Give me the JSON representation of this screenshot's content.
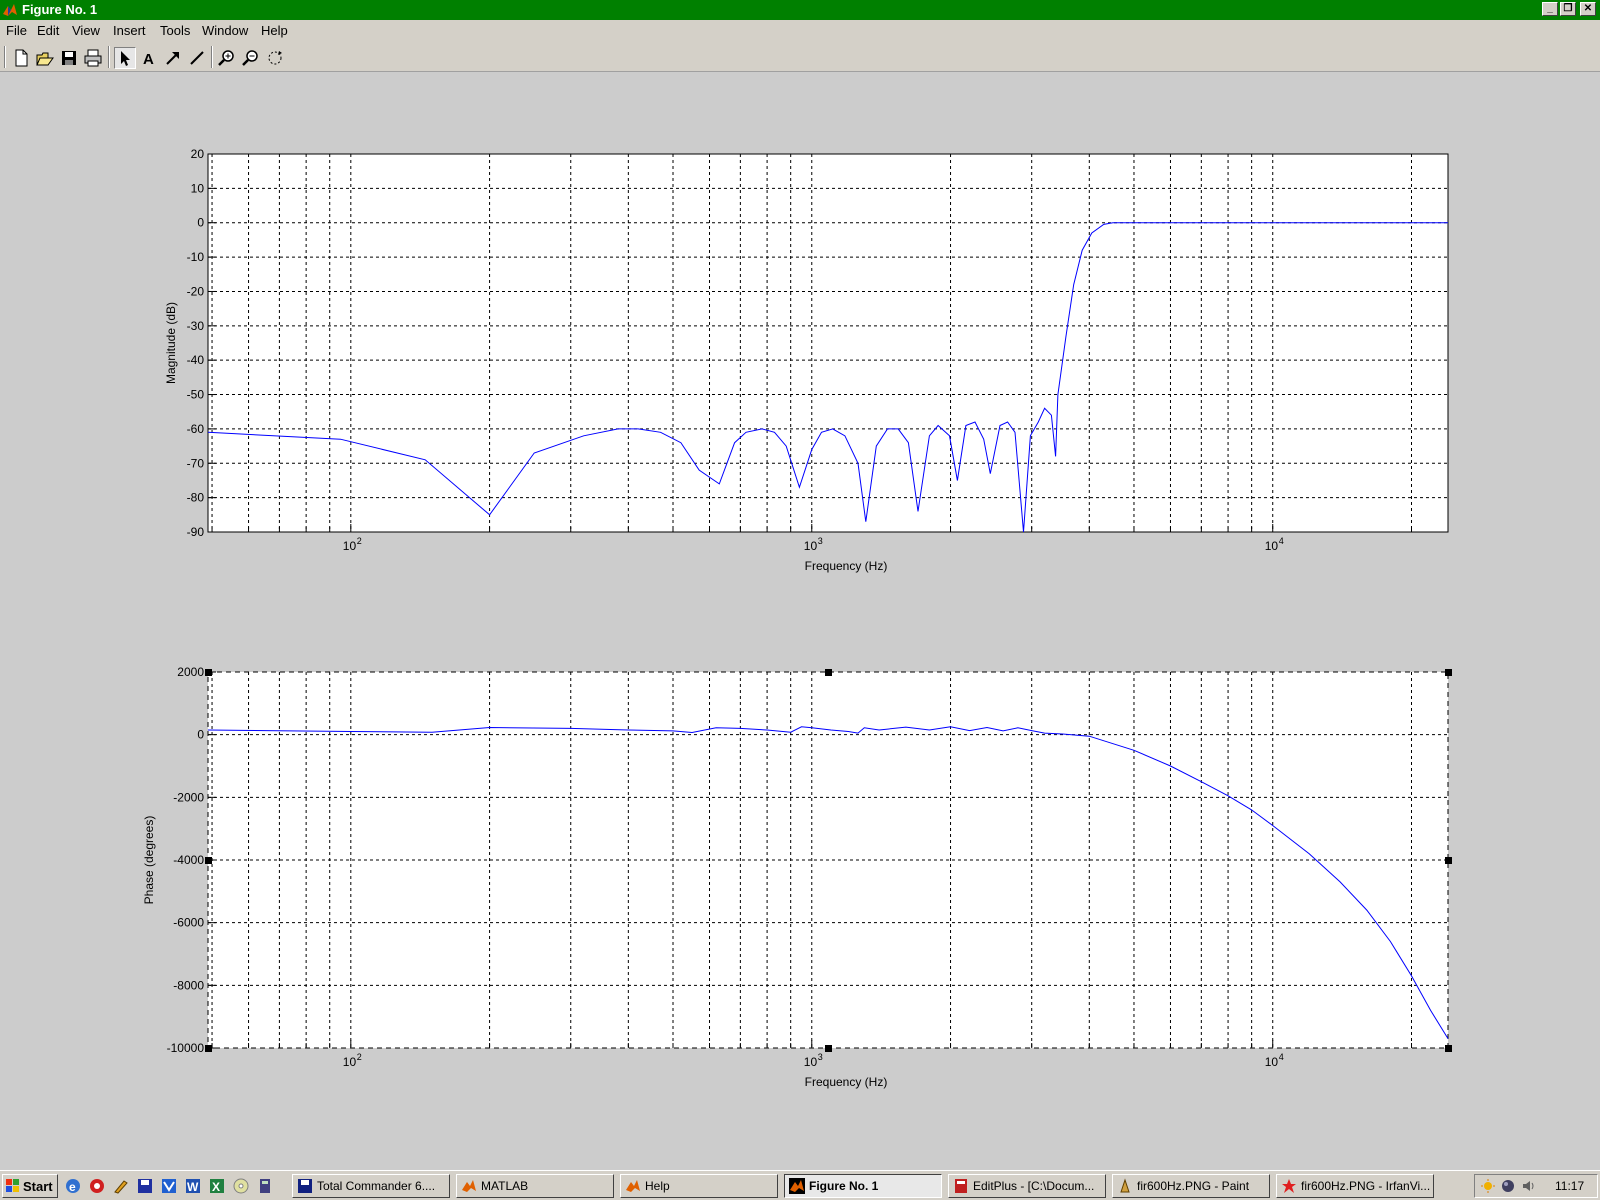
{
  "window": {
    "title": "Figure No. 1",
    "buttons": {
      "minimize": "_",
      "restore": "❐",
      "close": "✕"
    }
  },
  "menu": {
    "items": [
      "File",
      "Edit",
      "View",
      "Insert",
      "Tools",
      "Window",
      "Help"
    ]
  },
  "toolbar": {
    "tools": [
      "new-icon",
      "open-icon",
      "save-icon",
      "print-icon",
      "select-arrow-icon",
      "text-icon",
      "arrow-icon",
      "line-icon",
      "zoom-in-icon",
      "zoom-out-icon",
      "rotate-icon"
    ],
    "active_tool": "select-arrow-icon"
  },
  "chart_data": [
    {
      "type": "line",
      "title": "",
      "xlabel": "Frequency (Hz)",
      "ylabel": "Magnitude (dB)",
      "xscale": "log",
      "xlim": [
        49,
        24000
      ],
      "ylim": [
        -90,
        20
      ],
      "yticks": [
        "20",
        "10",
        "0",
        "-10",
        "-20",
        "-30",
        "-40",
        "-50",
        "-60",
        "-70",
        "-80",
        "-90"
      ],
      "xticks": [
        {
          "base": "10",
          "exp": "2",
          "value": 100
        },
        {
          "base": "10",
          "exp": "3",
          "value": 1000
        },
        {
          "base": "10",
          "exp": "4",
          "value": 10000
        }
      ],
      "grid": true,
      "color": "#0000ff",
      "series": [
        {
          "x": [
            49,
            95,
            145,
            200,
            250,
            320,
            380,
            420,
            470,
            520,
            570,
            630,
            680,
            720,
            780,
            830,
            880,
            940,
            1000,
            1050,
            1110,
            1180,
            1260,
            1310,
            1380,
            1460,
            1540,
            1620,
            1700,
            1800,
            1880,
            1990,
            2070,
            2160,
            2260,
            2360,
            2440,
            2560,
            2660,
            2760,
            2880,
            2980,
            3100,
            3200,
            3310,
            3380,
            3420,
            3560,
            3700,
            3860,
            4050,
            4300,
            4500,
            4700,
            5000,
            6000,
            10000,
            24000
          ],
          "y": [
            -61,
            -63,
            -69,
            -85,
            -67,
            -62,
            -60,
            -60,
            -61,
            -64,
            -72,
            -76,
            -64,
            -61,
            -60,
            -61,
            -65,
            -77,
            -66,
            -61,
            -60,
            -62,
            -70,
            -87,
            -65,
            -60,
            -60,
            -64,
            -84,
            -62,
            -59,
            -62,
            -75,
            -59,
            -58,
            -63,
            -73,
            -59,
            -58,
            -61,
            -90,
            -62,
            -58,
            -54,
            -56,
            -68,
            -50,
            -33,
            -18,
            -8,
            -3,
            -0.5,
            0,
            0,
            0,
            0,
            0,
            0
          ]
        }
      ]
    },
    {
      "type": "line",
      "title": "",
      "xlabel": "Frequency (Hz)",
      "ylabel": "Phase (degrees)",
      "xscale": "log",
      "xlim": [
        49,
        24000
      ],
      "ylim": [
        -10000,
        2000
      ],
      "yticks": [
        "2000",
        "0",
        "-2000",
        "-4000",
        "-6000",
        "-8000",
        "-10000"
      ],
      "xticks": [
        {
          "base": "10",
          "exp": "2",
          "value": 100
        },
        {
          "base": "10",
          "exp": "3",
          "value": 1000
        },
        {
          "base": "10",
          "exp": "4",
          "value": 10000
        }
      ],
      "grid": true,
      "color": "#0000ff",
      "selected": true,
      "series": [
        {
          "x": [
            49,
            100,
            150,
            200,
            300,
            400,
            500,
            550,
            620,
            700,
            800,
            900,
            950,
            1000,
            1100,
            1200,
            1260,
            1300,
            1400,
            1600,
            1800,
            2000,
            2200,
            2400,
            2600,
            2800,
            3000,
            3200,
            3500,
            4000,
            5000,
            6000,
            7000,
            8000,
            9000,
            10000,
            12000,
            14000,
            16000,
            18000,
            20000,
            22000,
            24000
          ],
          "y": [
            150,
            100,
            80,
            230,
            200,
            150,
            120,
            70,
            220,
            200,
            150,
            80,
            250,
            220,
            150,
            100,
            50,
            220,
            150,
            240,
            150,
            250,
            130,
            230,
            120,
            220,
            130,
            50,
            20,
            -50,
            -500,
            -1000,
            -1500,
            -1950,
            -2400,
            -2900,
            -3800,
            -4700,
            -5600,
            -6600,
            -7700,
            -8800,
            -9700
          ]
        }
      ]
    }
  ],
  "taskbar": {
    "start_label": "Start",
    "quick_launch": [
      "ie-icon",
      "media-icon",
      "tools-icon",
      "save-icon",
      "vs-icon",
      "word-icon",
      "excel-icon",
      "cd-icon",
      "calc-icon"
    ],
    "tasks": [
      {
        "label": "Total Commander 6....",
        "icon": "disk-icon",
        "active": false
      },
      {
        "label": "MATLAB",
        "icon": "matlab-icon",
        "active": false
      },
      {
        "label": "Help",
        "icon": "matlab-icon",
        "active": false
      },
      {
        "label": "Figure No. 1",
        "icon": "matlab-icon",
        "active": true
      },
      {
        "label": "EditPlus - [C:\\Docum...",
        "icon": "editplus-icon",
        "active": false
      },
      {
        "label": "fir600Hz.PNG - Paint",
        "icon": "paint-icon",
        "active": false
      },
      {
        "label": "fir600Hz.PNG - IrfanVi...",
        "icon": "irfanview-icon",
        "active": false
      }
    ],
    "tray_icons": [
      "sun-icon",
      "ball-icon",
      "volume-icon"
    ],
    "clock": "11:17"
  }
}
